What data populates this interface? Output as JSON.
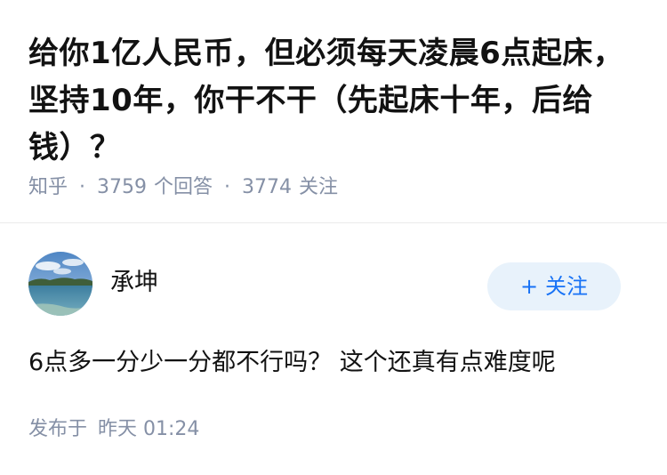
{
  "question": {
    "title": "给你1亿人民币，但必须每天凌晨6点起床，坚持10年，你干不干（先起床十年，后给钱）？",
    "source": "知乎",
    "separator": "·",
    "answer_count": "3759",
    "answer_label": "个回答",
    "follower_count": "3774",
    "follower_label": "关注"
  },
  "answer": {
    "author": {
      "name": "承坤",
      "avatar_icon": "lake-landscape-avatar"
    },
    "follow_button": {
      "plus": "+",
      "label": "关注"
    },
    "content": "6点多一分少一分都不行吗？ 这个还真有点难度呢",
    "publish_prefix": "发布于",
    "publish_time": "昨天 01:24"
  },
  "colors": {
    "text": "#121212",
    "meta": "#8590a6",
    "accent": "#1772f6",
    "follow_bg": "#e8f2fb",
    "divider": "#ebebeb"
  }
}
